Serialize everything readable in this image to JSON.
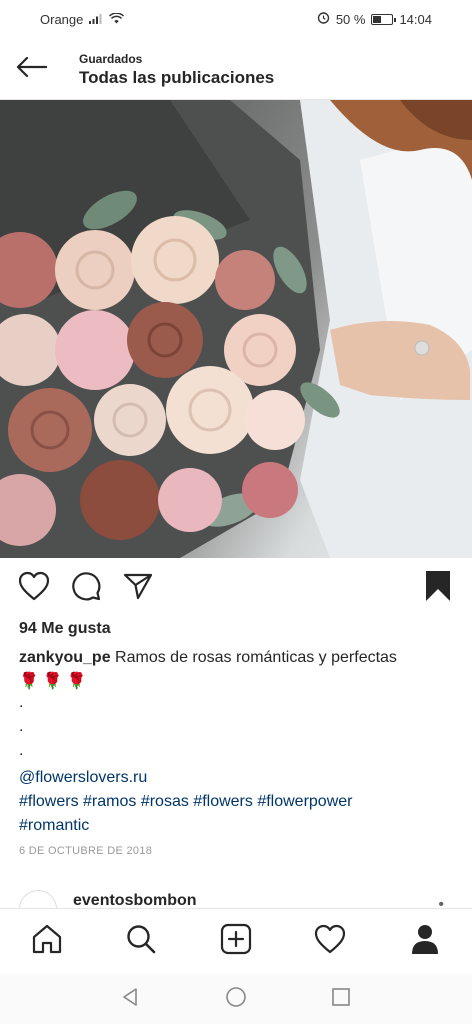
{
  "status_bar": {
    "carrier": "Orange",
    "battery_percent": "50 %",
    "battery_level": 0.5,
    "time": "14:04",
    "icons": [
      "signal-icon",
      "wifi-icon",
      "alarm-icon",
      "battery-icon"
    ]
  },
  "header": {
    "subtitle": "Guardados",
    "title": "Todas las publicaciones",
    "back_icon": "back-arrow-icon"
  },
  "post": {
    "image_description_icon": "photo",
    "actions": [
      "heart-icon",
      "comment-icon",
      "share-icon",
      "bookmark-icon"
    ],
    "likes": "94 Me gusta",
    "username": "zankyou_pe",
    "caption": " Ramos de rosas románticas y perfectas",
    "emojis": "🌹🌹🌹",
    "dots": [
      ".",
      ".",
      "."
    ],
    "mention": "@flowerslovers.ru",
    "hashtags_line1": "#flowers #ramos #rosas #flowers #flowerpower",
    "hashtags_line2": "#romantic",
    "date": "6 DE OCTUBRE DE 2018"
  },
  "next_post": {
    "username": "eventosbombon",
    "more": "•"
  },
  "bottom_nav": [
    "home-icon",
    "search-icon",
    "add-post-icon",
    "activity-heart-icon",
    "profile-icon"
  ],
  "system_nav": [
    "android-back-icon",
    "android-home-icon",
    "android-recents-icon"
  ],
  "colors": {
    "link": "#003569",
    "text": "#262626",
    "muted": "#999999"
  }
}
